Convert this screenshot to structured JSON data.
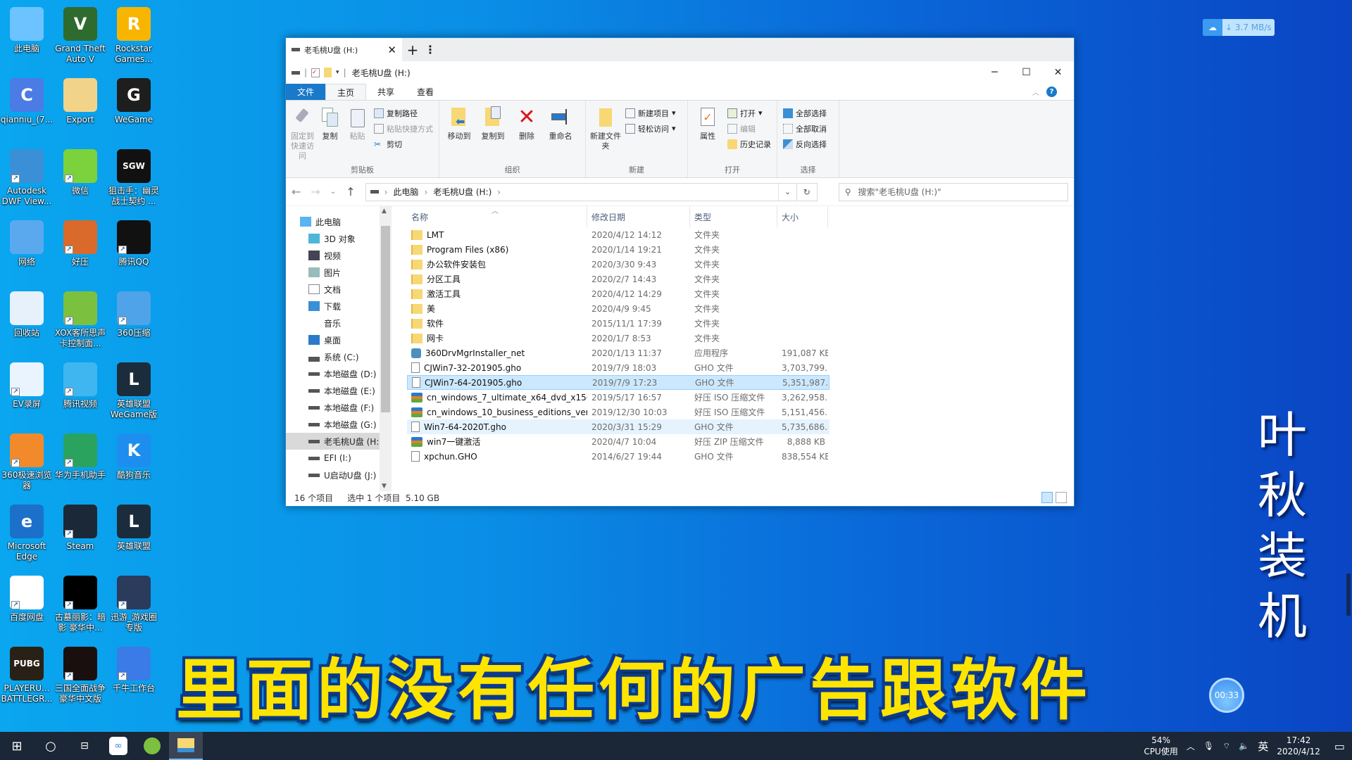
{
  "desktop": {
    "icons": [
      {
        "label": "此电脑",
        "icon": "this-pc-icon",
        "color": "#6cc3ff"
      },
      {
        "label": "Grand Theft Auto V",
        "icon": "gta-v-icon",
        "color": "#2e6b2e",
        "glyph": "V"
      },
      {
        "label": "Rockstar Games...",
        "icon": "rockstar-icon",
        "color": "#f7b500",
        "glyph": "R"
      },
      {
        "label": "qianniu_(7...",
        "icon": "qianniu-icon",
        "color": "#4b7be5",
        "glyph": "C"
      },
      {
        "label": "Export",
        "icon": "export-folder-icon",
        "color": "#f1d38a"
      },
      {
        "label": "WeGame",
        "icon": "wegame-icon",
        "color": "#1e1e1e",
        "glyph": "G"
      },
      {
        "label": "Autodesk DWF View...",
        "icon": "autodesk-dwf-icon",
        "color": "#3b8fd6"
      },
      {
        "label": "微信",
        "icon": "wechat-icon",
        "color": "#7bd23c"
      },
      {
        "label": "狙击手：幽灵战士契约 ...",
        "icon": "sgw-icon",
        "color": "#111",
        "glyph": "SGW"
      },
      {
        "label": "网络",
        "icon": "network-icon",
        "color": "#5aa9ef"
      },
      {
        "label": "好压",
        "icon": "haozip-icon",
        "color": "#d96a2b"
      },
      {
        "label": "腾讯QQ",
        "icon": "qq-icon",
        "color": "#111"
      },
      {
        "label": "回收站",
        "icon": "recycle-bin-icon",
        "color": "#e6f1fb"
      },
      {
        "label": "XOX客所思声卡控制面...",
        "icon": "xox-sound-icon",
        "color": "#7bc13f"
      },
      {
        "label": "360压缩",
        "icon": "360zip-icon",
        "color": "#4fa3e8"
      },
      {
        "label": "EV录屏",
        "icon": "ev-recorder-icon",
        "color": "#eaf4ff"
      },
      {
        "label": "腾讯视频",
        "icon": "tencent-video-icon",
        "color": "#3fb6f0"
      },
      {
        "label": "英雄联盟WeGame版",
        "icon": "lol-wegame-icon",
        "color": "#1b2c3c",
        "glyph": "L"
      },
      {
        "label": "360极速浏览器",
        "icon": "360-browser-icon",
        "color": "#f28a2b"
      },
      {
        "label": "华为手机助手",
        "icon": "huawei-assistant-icon",
        "color": "#2aa35f"
      },
      {
        "label": "酷狗音乐",
        "icon": "kugou-icon",
        "color": "#1d8ef0",
        "glyph": "K"
      },
      {
        "label": "Microsoft Edge",
        "icon": "edge-icon",
        "color": "#1b70c9",
        "glyph": "e"
      },
      {
        "label": "Steam",
        "icon": "steam-icon",
        "color": "#1b2838"
      },
      {
        "label": "英雄联盟",
        "icon": "lol-icon",
        "color": "#1b2c3c",
        "glyph": "L"
      },
      {
        "label": "百度网盘",
        "icon": "baidu-netdisk-icon",
        "color": "#fff"
      },
      {
        "label": "古墓丽影：暗影 豪华中...",
        "icon": "tomb-raider-icon",
        "color": "#000"
      },
      {
        "label": "迅游_游戏圈专版",
        "icon": "xunyou-icon",
        "color": "#2b3b5c"
      },
      {
        "label": "PLAYERU... BATTLEGR...",
        "icon": "pubg-icon",
        "color": "#2a2116",
        "glyph": "PUBG"
      },
      {
        "label": "三国全面战争豪华中文版",
        "icon": "three-kingdoms-icon",
        "color": "#1a0f0f"
      },
      {
        "label": "千牛工作台",
        "icon": "qianniu-workbench-icon",
        "color": "#3a7be8"
      }
    ]
  },
  "explorer": {
    "tab_title": "老毛桃U盘 (H:)",
    "window_title": "老毛桃U盘 (H:)",
    "ribbon_tabs": [
      "文件",
      "主页",
      "共享",
      "查看"
    ],
    "ribbon": {
      "clipboard": {
        "label": "剪贴板",
        "pin": "固定到快速访问",
        "copy": "复制",
        "paste": "粘贴",
        "copy_path": "复制路径",
        "paste_shortcut": "粘贴快捷方式",
        "cut": "剪切"
      },
      "organize": {
        "label": "组织",
        "move_to": "移动到",
        "copy_to": "复制到",
        "delete": "删除",
        "rename": "重命名"
      },
      "new": {
        "label": "新建",
        "new_folder": "新建文件夹",
        "new_item": "新建项目",
        "easy_access": "轻松访问"
      },
      "open": {
        "label": "打开",
        "properties": "属性",
        "open": "打开",
        "edit": "编辑",
        "history": "历史记录"
      },
      "select": {
        "label": "选择",
        "select_all": "全部选择",
        "select_none": "全部取消",
        "invert": "反向选择"
      }
    },
    "breadcrumb": [
      "此电脑",
      "老毛桃U盘 (H:)"
    ],
    "search_placeholder": "搜索\"老毛桃U盘 (H:)\"",
    "nav_tree": [
      {
        "label": "此电脑",
        "icon": "pc",
        "level": 0
      },
      {
        "label": "3D 对象",
        "icon": "3d",
        "level": 1
      },
      {
        "label": "视频",
        "icon": "video",
        "level": 1
      },
      {
        "label": "图片",
        "icon": "pictures",
        "level": 1
      },
      {
        "label": "文档",
        "icon": "documents",
        "level": 1
      },
      {
        "label": "下载",
        "icon": "downloads",
        "level": 1
      },
      {
        "label": "音乐",
        "icon": "music",
        "level": 1
      },
      {
        "label": "桌面",
        "icon": "desktop",
        "level": 1
      },
      {
        "label": "系统 (C:)",
        "icon": "sysdrive",
        "level": 1
      },
      {
        "label": "本地磁盘 (D:)",
        "icon": "drive",
        "level": 1
      },
      {
        "label": "本地磁盘 (E:)",
        "icon": "drive",
        "level": 1
      },
      {
        "label": "本地磁盘 (F:)",
        "icon": "drive",
        "level": 1
      },
      {
        "label": "本地磁盘 (G:)",
        "icon": "drive",
        "level": 1
      },
      {
        "label": "老毛桃U盘 (H:)",
        "icon": "drive",
        "level": 1,
        "selected": true
      },
      {
        "label": "EFI (I:)",
        "icon": "drive",
        "level": 1
      },
      {
        "label": "U启动U盘 (J:)",
        "icon": "drive",
        "level": 1
      }
    ],
    "columns": [
      "名称",
      "修改日期",
      "类型",
      "大小"
    ],
    "files": [
      {
        "name": "LMT",
        "date": "2020/4/12 14:12",
        "type": "文件夹",
        "size": "",
        "kind": "folder"
      },
      {
        "name": "Program Files (x86)",
        "date": "2020/1/14 19:21",
        "type": "文件夹",
        "size": "",
        "kind": "folder"
      },
      {
        "name": "办公软件安装包",
        "date": "2020/3/30 9:43",
        "type": "文件夹",
        "size": "",
        "kind": "folder"
      },
      {
        "name": "分区工具",
        "date": "2020/2/7 14:43",
        "type": "文件夹",
        "size": "",
        "kind": "folder"
      },
      {
        "name": "激活工具",
        "date": "2020/4/12 14:29",
        "type": "文件夹",
        "size": "",
        "kind": "folder"
      },
      {
        "name": "美",
        "date": "2020/4/9 9:45",
        "type": "文件夹",
        "size": "",
        "kind": "folder"
      },
      {
        "name": "软件",
        "date": "2015/11/1 17:39",
        "type": "文件夹",
        "size": "",
        "kind": "folder"
      },
      {
        "name": "网卡",
        "date": "2020/1/7 8:53",
        "type": "文件夹",
        "size": "",
        "kind": "folder"
      },
      {
        "name": "360DrvMgrInstaller_net",
        "date": "2020/1/13 11:37",
        "type": "应用程序",
        "size": "191,087 KB",
        "kind": "exe"
      },
      {
        "name": "CJWin7-32-201905.gho",
        "date": "2019/7/9 18:03",
        "type": "GHO 文件",
        "size": "3,703,799...",
        "kind": "doc"
      },
      {
        "name": "CJWin7-64-201905.gho",
        "date": "2019/7/9 17:23",
        "type": "GHO 文件",
        "size": "5,351,987...",
        "kind": "doc",
        "selected": true
      },
      {
        "name": "cn_windows_7_ultimate_x64_dvd_x15-...",
        "date": "2019/5/17 16:57",
        "type": "好压 ISO 压缩文件",
        "size": "3,262,958...",
        "kind": "arch"
      },
      {
        "name": "cn_windows_10_business_editions_ver...",
        "date": "2019/12/30 10:03",
        "type": "好压 ISO 压缩文件",
        "size": "5,151,456...",
        "kind": "arch"
      },
      {
        "name": "Win7-64-2020T.gho",
        "date": "2020/3/31 15:29",
        "type": "GHO 文件",
        "size": "5,735,686...",
        "kind": "doc",
        "hover": true
      },
      {
        "name": "win7一键激活",
        "date": "2020/4/7 10:04",
        "type": "好压 ZIP 压缩文件",
        "size": "8,888 KB",
        "kind": "arch"
      },
      {
        "name": "xpchun.GHO",
        "date": "2014/6/27 19:44",
        "type": "GHO 文件",
        "size": "838,554 KB",
        "kind": "doc"
      }
    ],
    "status": {
      "count": "16 个项目",
      "selected": "选中 1 个项目",
      "size": "5.10 GB"
    }
  },
  "overlay": {
    "net_speed": "3.7 MB/s",
    "vertical_title": [
      "叶",
      "秋",
      "装",
      "机"
    ],
    "caption": "里面的没有任何的广告跟软件",
    "timer": "00:33"
  },
  "taskbar": {
    "cpu_percent": "54%",
    "cpu_label": "CPU使用",
    "ime": "英",
    "time": "17:42",
    "date": "2020/4/12"
  },
  "colors": {
    "accent": "#1979ca",
    "selection": "#cce8ff",
    "caption": "#ffe400"
  }
}
